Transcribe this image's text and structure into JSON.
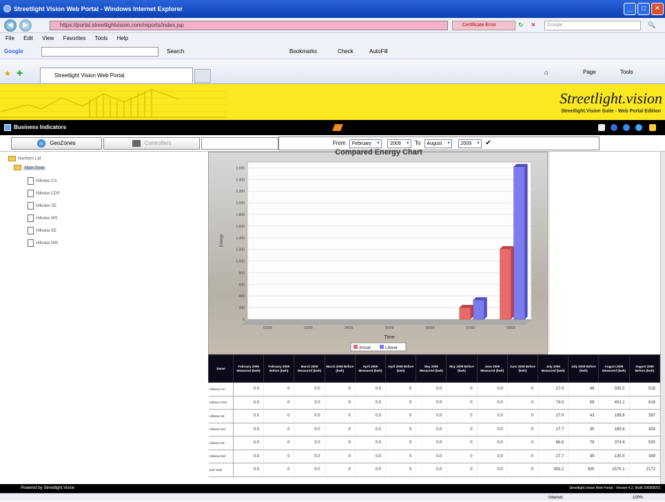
{
  "window": {
    "title": "Streetlight Vision Web Portal - Windows Internet Explorer"
  },
  "address": {
    "url": "https://portal.streetlightvision.com/reports/index.jsp",
    "certificate": "Certificate Error",
    "search_placeholder": "Google"
  },
  "menu": [
    "File",
    "Edit",
    "View",
    "Favorites",
    "Tools",
    "Help"
  ],
  "google_toolbar": {
    "label": "Google",
    "search_label": "Search",
    "bookmarks": "Bookmarks",
    "check": "Check",
    "autofill": "AutoFill"
  },
  "tab": {
    "label": "Streetlight Vision Web Portal"
  },
  "ie_tools": {
    "page": "Page",
    "tools": "Tools"
  },
  "brand": {
    "name": "Streetlight.vision",
    "sub": "Streetlight.Vision Suite - Web Portal Edition"
  },
  "toolbar": {
    "title": "Business Indicators"
  },
  "tabs": {
    "geozones": "GeoZones",
    "controllers": "Controllers"
  },
  "dates": {
    "from_label": "From",
    "from_month": "February",
    "from_year": "2009",
    "to_label": "To",
    "to_month": "August",
    "to_year": "2009"
  },
  "tree": {
    "root": "Northern Ltd",
    "group": "Main Zone",
    "items": [
      "Hillview CS",
      "Hillview CDS",
      "Hillview SE",
      "Hillview WS",
      "Hillview SE",
      "Hillview NW"
    ]
  },
  "colors": {
    "banner": "#fbe81e",
    "actual": "#e86a6a",
    "lifeval": "#7c7cf0"
  },
  "chart_data": {
    "type": "bar",
    "title": "Compared Energy Chart",
    "xlabel": "Time",
    "ylabel": "Energy",
    "ylim": [
      0,
      2700
    ],
    "yticks": [
      "0",
      "200",
      "400",
      "600",
      "800",
      "1,000",
      "1,200",
      "1,400",
      "1,600",
      "1,800",
      "2,000",
      "2,200",
      "2,400",
      "2,600"
    ],
    "categories": [
      "02/09",
      "03/09",
      "04/09",
      "05/09",
      "06/09",
      "07/09",
      "08/09"
    ],
    "series": [
      {
        "name": "Actual",
        "values": [
          0,
          0,
          0,
          0,
          0,
          200,
          1210
        ]
      },
      {
        "name": "Lifeval",
        "values": [
          0,
          0,
          0,
          0,
          0,
          330,
          2620
        ]
      }
    ]
  },
  "table": {
    "headers": [
      "Name",
      "February 2009 Measured (kwh)",
      "February 2009 Before (kwh)",
      "March 2009 Measured (kwh)",
      "March 2009 Before (kwh)",
      "April 2009 Measured (kwh)",
      "April 2009 Before (kwh)",
      "May 2009 Measured (kwh)",
      "May 2009 Before (kwh)",
      "June 2009 Measured (kwh)",
      "June 2009 Before (kwh)",
      "July 2009 Measured (kwh)",
      "July 2009 Before (kwh)",
      "August 2009 Measured (kwh)",
      "August 2009 Before (kwh)"
    ],
    "rows": [
      [
        "Hillview CS",
        "0.0",
        "0",
        "0.0",
        "0",
        "0.0",
        "0",
        "0.0",
        "0",
        "0.0",
        "0",
        "27.0",
        "46",
        "335.5",
        "516"
      ],
      [
        "Hillview CDS",
        "0.0",
        "0",
        "0.0",
        "0",
        "0.0",
        "0",
        "0.0",
        "0",
        "0.0",
        "0",
        "74.0",
        "56",
        "401.1",
        "616"
      ],
      [
        "Hillview SE",
        "0.0",
        "0",
        "0.0",
        "0",
        "0.0",
        "0",
        "0.0",
        "0",
        "0.0",
        "0",
        "27.0",
        "43",
        "196.6",
        "397"
      ],
      [
        "Hillview WS",
        "0.0",
        "0",
        "0.0",
        "0",
        "0.0",
        "0",
        "0.0",
        "0",
        "0.0",
        "0",
        "27.7",
        "35",
        "185.6",
        "433"
      ],
      [
        "Hillview SE",
        "0.0",
        "0",
        "0.0",
        "0",
        "0.0",
        "0",
        "0.0",
        "0",
        "0.0",
        "0",
        "86.8",
        "78",
        "374.8",
        "530"
      ],
      [
        "Hillview NW",
        "0.0",
        "0",
        "0.0",
        "0",
        "0.0",
        "0",
        "0.0",
        "0",
        "0.0",
        "0",
        "27.7",
        "39",
        "135.5",
        "349"
      ],
      [
        "Sub Total",
        "0.0",
        "0",
        "0.0",
        "0",
        "0.0",
        "0",
        "0.0",
        "0",
        "0.0",
        "0",
        "393.2",
        "305",
        "1570.1",
        "2172"
      ]
    ]
  },
  "footer": {
    "left": "Powered by Streetlight.Vision",
    "right": "Streetlight.Vision Web Portal - Version 4.2, Build 200908201"
  },
  "status": {
    "zone": "Internet",
    "zoom": "100%"
  }
}
